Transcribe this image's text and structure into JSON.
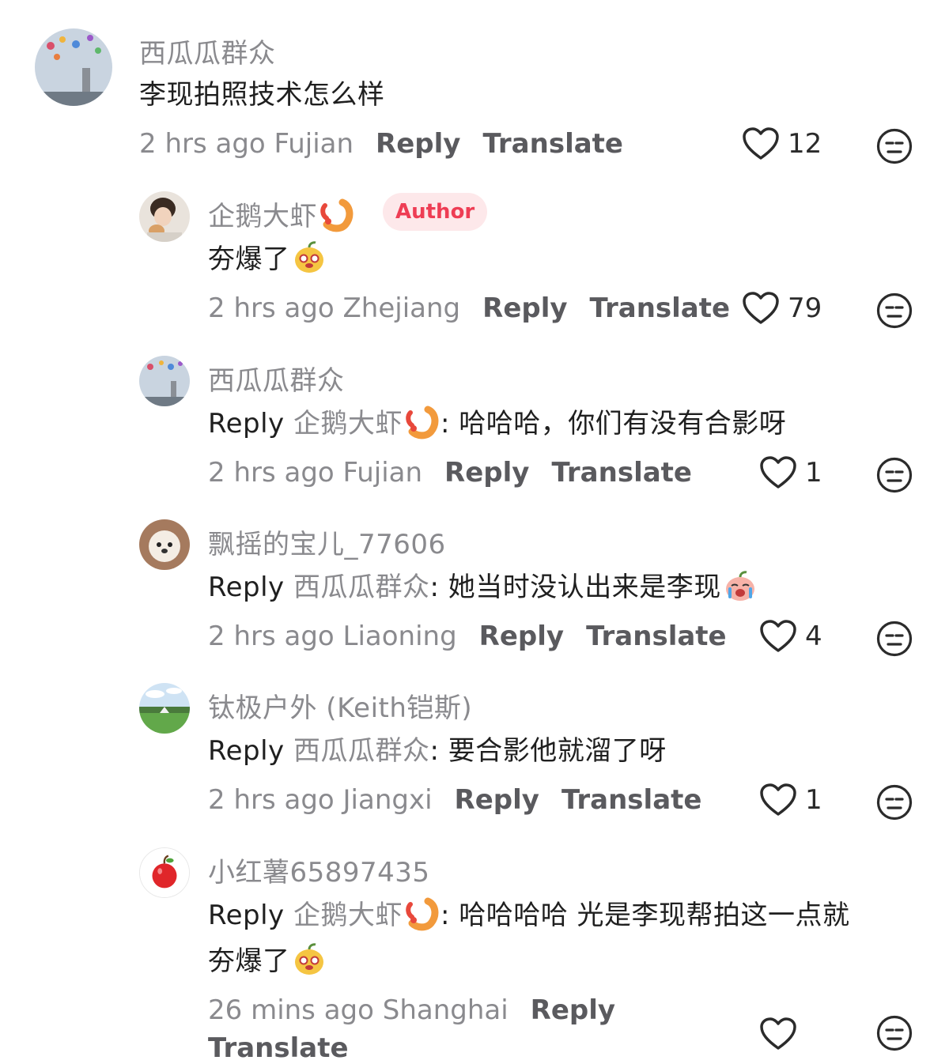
{
  "comments": [
    {
      "user": "西瓜瓜群众",
      "text": "李现拍照技术怎么样",
      "time_loc": "2 hrs ago Fujian",
      "reply_label": "Reply",
      "translate_label": "Translate",
      "likes": "12"
    },
    {
      "user": "企鹅大虾",
      "badge": "Author",
      "text": "夯爆了",
      "time_loc": "2 hrs ago Zhejiang",
      "reply_label": "Reply",
      "translate_label": "Translate",
      "likes": "79"
    },
    {
      "user": "西瓜瓜群众",
      "reply_prefix": "Reply",
      "reply_to": "企鹅大虾",
      "text": ": 哈哈哈，你们有没有合影呀",
      "time_loc": "2 hrs ago Fujian",
      "reply_label": "Reply",
      "translate_label": "Translate",
      "likes": "1"
    },
    {
      "user": "飘摇的宝儿_77606",
      "reply_prefix": "Reply",
      "reply_to": "西瓜瓜群众",
      "text": ": 她当时没认出来是李现",
      "time_loc": "2 hrs ago Liaoning",
      "reply_label": "Reply",
      "translate_label": "Translate",
      "likes": "4"
    },
    {
      "user": "钛极户外 (Keith铠斯)",
      "reply_prefix": "Reply",
      "reply_to": "西瓜瓜群众",
      "text": ": 要合影他就溜了呀",
      "time_loc": "2 hrs ago Jiangxi",
      "reply_label": "Reply",
      "translate_label": "Translate",
      "likes": "1"
    },
    {
      "user": "小红薯65897435",
      "reply_prefix": "Reply",
      "reply_to": "企鹅大虾",
      "text": ": 哈哈哈哈 光是李现帮拍这一点就",
      "text_line2": "夯爆了",
      "time_loc": "26 mins ago Shanghai",
      "reply_label": "Reply",
      "translate_label": "Translate"
    }
  ],
  "icons": {
    "like": "heart-outline-icon",
    "react": "neutral-face-icon",
    "shrimp": "shrimp-emoji",
    "mango": "mango-face-emoji",
    "crying": "crying-peach-emoji"
  },
  "colors": {
    "muted": "#8a8a8e",
    "text": "#1f1f1f",
    "action": "#5a5a5e",
    "author_badge_bg": "#fde8ea",
    "author_badge_fg": "#ee3d54"
  }
}
